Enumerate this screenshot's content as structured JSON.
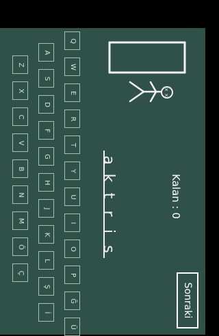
{
  "keyboard": {
    "rows": [
      [
        "Q",
        "W",
        "E",
        "R",
        "T",
        "Y",
        "U",
        "I",
        "O",
        "P",
        "Ğ",
        "Ü"
      ],
      [
        "A",
        "S",
        "D",
        "F",
        "G",
        "H",
        "J",
        "K",
        "L",
        "Ş",
        "İ"
      ],
      [
        "Z",
        "X",
        "C",
        "V",
        "B",
        "N",
        "M",
        "Ö",
        "Ç"
      ]
    ]
  },
  "word": {
    "letters": [
      "a",
      "k",
      "t",
      "r",
      "i",
      "s"
    ]
  },
  "status": {
    "remaining": "Kalan : 0"
  },
  "actions": {
    "next_label": "Sonraki"
  }
}
